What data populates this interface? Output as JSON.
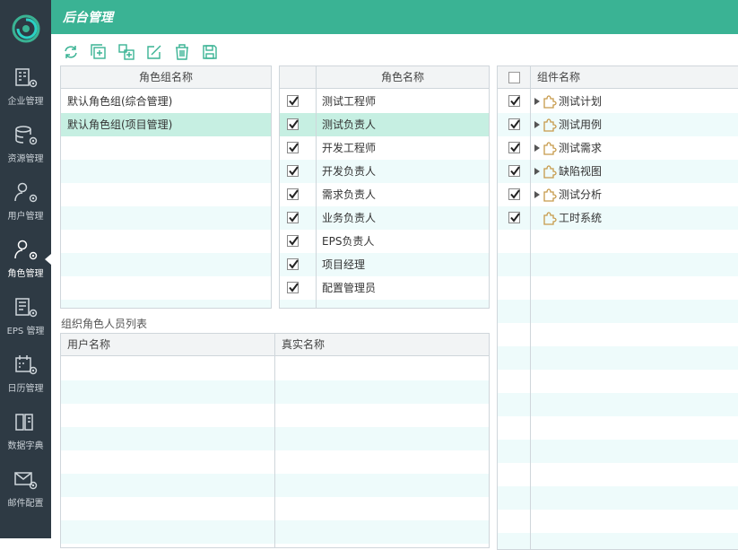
{
  "app": {
    "title": "后台管理",
    "accent": "#3ab394",
    "sidebar_bg": "#2e3a44"
  },
  "sidebar": {
    "items": [
      {
        "label": "企业管理",
        "icon": "building-gear-icon"
      },
      {
        "label": "资源管理",
        "icon": "database-gear-icon"
      },
      {
        "label": "用户管理",
        "icon": "user-gear-icon"
      },
      {
        "label": "角色管理",
        "icon": "role-gear-icon",
        "active": true
      },
      {
        "label": "EPS 管理",
        "icon": "eps-gear-icon"
      },
      {
        "label": "日历管理",
        "icon": "calendar-gear-icon"
      },
      {
        "label": "数据字典",
        "icon": "book-icon"
      },
      {
        "label": "邮件配置",
        "icon": "mail-gear-icon"
      }
    ]
  },
  "toolbar": {
    "buttons": [
      {
        "icon": "refresh-icon",
        "name": "refresh-button"
      },
      {
        "icon": "add-icon",
        "name": "add-button"
      },
      {
        "icon": "copy-add-icon",
        "name": "copy-button"
      },
      {
        "icon": "edit-icon",
        "name": "edit-button"
      },
      {
        "icon": "delete-icon",
        "name": "delete-button"
      },
      {
        "icon": "save-icon",
        "name": "save-button"
      }
    ]
  },
  "role_groups": {
    "header": "角色组名称",
    "rows": [
      "默认角色组(综合管理)",
      "默认角色组(项目管理)"
    ],
    "selected_index": 1
  },
  "roles": {
    "header": "角色名称",
    "rows": [
      {
        "label": "测试工程师",
        "checked": true
      },
      {
        "label": "测试负责人",
        "checked": true
      },
      {
        "label": "开发工程师",
        "checked": true
      },
      {
        "label": "开发负责人",
        "checked": true
      },
      {
        "label": "需求负责人",
        "checked": true
      },
      {
        "label": "业务负责人",
        "checked": true
      },
      {
        "label": "EPS负责人",
        "checked": true
      },
      {
        "label": "项目经理",
        "checked": true
      },
      {
        "label": "配置管理员",
        "checked": true
      }
    ],
    "selected_index": 1
  },
  "members": {
    "section_label": "组织角色人员列表",
    "headers": [
      "用户名称",
      "真实名称"
    ],
    "rows": []
  },
  "components": {
    "header": "组件名称",
    "rows": [
      {
        "label": "测试计划",
        "checked": true,
        "expandable": true
      },
      {
        "label": "测试用例",
        "checked": true,
        "expandable": true
      },
      {
        "label": "测试需求",
        "checked": true,
        "expandable": true
      },
      {
        "label": "缺陷视图",
        "checked": true,
        "expandable": true
      },
      {
        "label": "测试分析",
        "checked": true,
        "expandable": true
      },
      {
        "label": "工时系统",
        "checked": true,
        "expandable": false
      }
    ]
  }
}
